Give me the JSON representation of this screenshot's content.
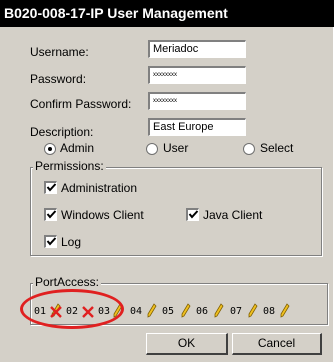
{
  "window": {
    "title": "B020-008-17-IP User Management"
  },
  "fields": {
    "username": {
      "label": "Username:",
      "value": "Meriadoc"
    },
    "password": {
      "label": "Password:",
      "value": "xxxxxxxx"
    },
    "confirm_password": {
      "label": "Confirm Password:",
      "value": "xxxxxxxx"
    },
    "description": {
      "label": "Description:",
      "value": "East Europe"
    }
  },
  "role": {
    "options": [
      "Admin",
      "User",
      "Select"
    ],
    "selected": "Admin"
  },
  "permissions": {
    "title": "Permissions:",
    "items": [
      {
        "label": "Administration",
        "checked": true
      },
      {
        "label": "Windows Client",
        "checked": true
      },
      {
        "label": "Java Client",
        "checked": true
      },
      {
        "label": "Log",
        "checked": true
      }
    ]
  },
  "port_access": {
    "title": "PortAccess:",
    "ports": [
      {
        "label": "01",
        "icon": "denied-x-icon"
      },
      {
        "label": "02",
        "icon": "denied-x-icon"
      },
      {
        "label": "03",
        "icon": "pencil-icon"
      },
      {
        "label": "04",
        "icon": "pencil-icon"
      },
      {
        "label": "05",
        "icon": "pencil-icon"
      },
      {
        "label": "06",
        "icon": "pencil-icon"
      },
      {
        "label": "07",
        "icon": "pencil-icon"
      },
      {
        "label": "08",
        "icon": "pencil-icon"
      }
    ]
  },
  "buttons": {
    "ok": "OK",
    "cancel": "Cancel"
  },
  "colors": {
    "highlight_circle": "#e02020",
    "deny_x": "#e02020",
    "pencil": "#f0c020"
  }
}
